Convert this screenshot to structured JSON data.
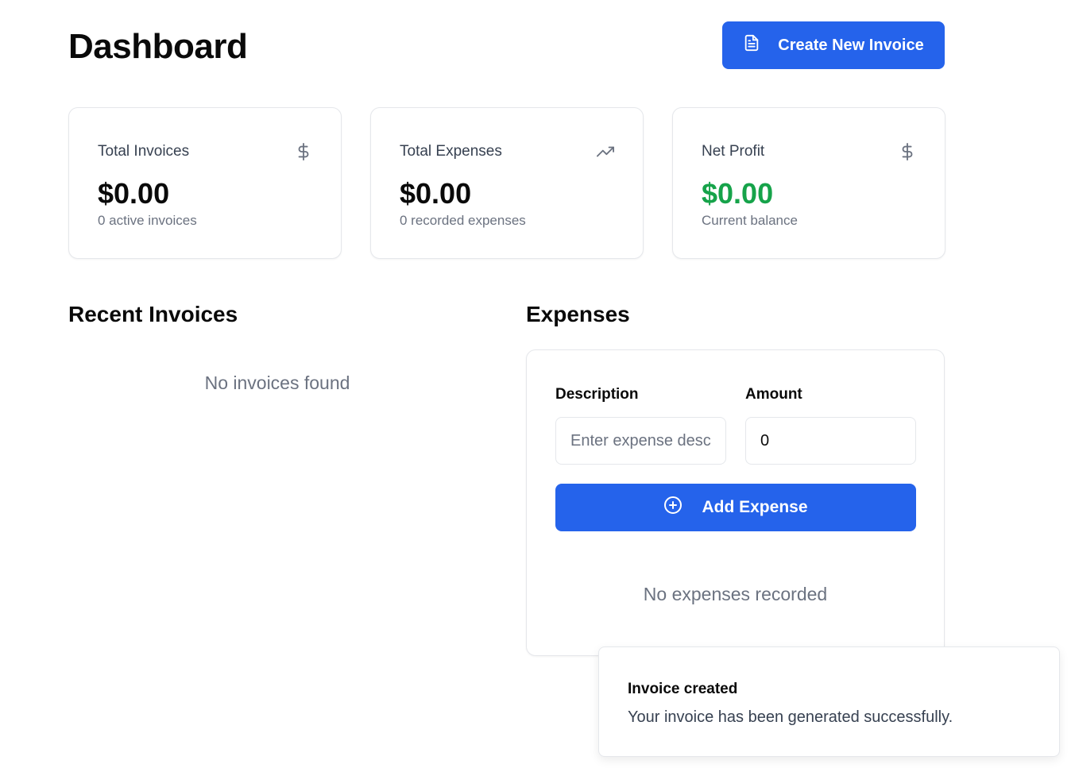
{
  "header": {
    "title": "Dashboard",
    "create_button_label": "Create New Invoice",
    "create_button_icon": "file-text-icon"
  },
  "stats": [
    {
      "label": "Total Invoices",
      "value": "$0.00",
      "sub": "0 active invoices",
      "icon": "dollar-icon"
    },
    {
      "label": "Total Expenses",
      "value": "$0.00",
      "sub": "0 recorded expenses",
      "icon": "trending-up-icon"
    },
    {
      "label": "Net Profit",
      "value": "$0.00",
      "sub": "Current balance",
      "icon": "dollar-icon",
      "value_color": "#16a34a"
    }
  ],
  "recent_invoices": {
    "title": "Recent Invoices",
    "empty_text": "No invoices found"
  },
  "expenses": {
    "title": "Expenses",
    "description_label": "Description",
    "description_placeholder": "Enter expense description",
    "description_value": "",
    "amount_label": "Amount",
    "amount_value": "0",
    "add_button_label": "Add Expense",
    "add_button_icon": "plus-circle-icon",
    "empty_text": "No expenses recorded"
  },
  "toast": {
    "title": "Invoice created",
    "description": "Your invoice has been generated successfully."
  },
  "colors": {
    "primary": "#2563eb",
    "profit": "#16a34a",
    "muted_text": "#6b7280",
    "border": "#e5e7eb"
  }
}
